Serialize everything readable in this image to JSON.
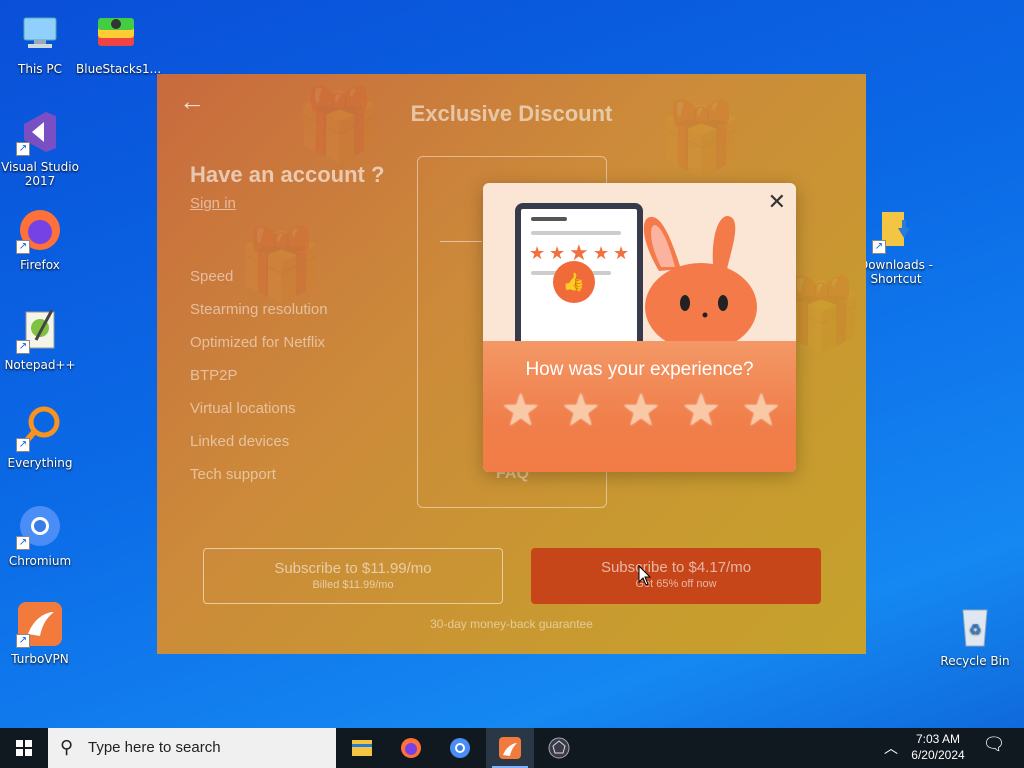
{
  "desktop": {
    "icons": [
      {
        "label": "This PC"
      },
      {
        "label": "BlueStacks1..."
      },
      {
        "label": "Visual Studio 2017"
      },
      {
        "label": "Firefox"
      },
      {
        "label": "Notepad++"
      },
      {
        "label": "Everything"
      },
      {
        "label": "Chromium"
      },
      {
        "label": "TurboVPN"
      },
      {
        "label": "Downloads - Shortcut"
      },
      {
        "label": "Recycle Bin"
      }
    ]
  },
  "app": {
    "title": "Exclusive Discount",
    "back_icon": "arrow-left-icon",
    "account_heading": "Have an account ?",
    "sign_in": "Sign in",
    "features": [
      "Speed",
      "Stearming resolution",
      "Optimized for Netflix",
      "BTP2P",
      "Virtual locations",
      "Linked devices",
      "Tech support"
    ],
    "faq": "FAQ",
    "plan_monthly": {
      "label": "Subscribe to $11.99/mo",
      "sub": "Billed $11.99/mo"
    },
    "plan_discount": {
      "label": "Subscribe to $4.17/mo",
      "sub": "Get 65% off now"
    },
    "guarantee": "30-day money-back guarantee"
  },
  "rating_popup": {
    "question": "How was your experience?",
    "stars": 5,
    "close_icon": "close-icon"
  },
  "taskbar": {
    "search_placeholder": "Type here to search",
    "time": "7:03 AM",
    "date": "6/20/2024",
    "apps": [
      "file-explorer-icon",
      "firefox-icon",
      "chromium-icon",
      "turbovpn-icon",
      "app-icon"
    ]
  },
  "colors": {
    "desktop_bg": "#0b6ae6",
    "popup_accent": "#f07f4b",
    "discount_button": "#c6461a"
  }
}
